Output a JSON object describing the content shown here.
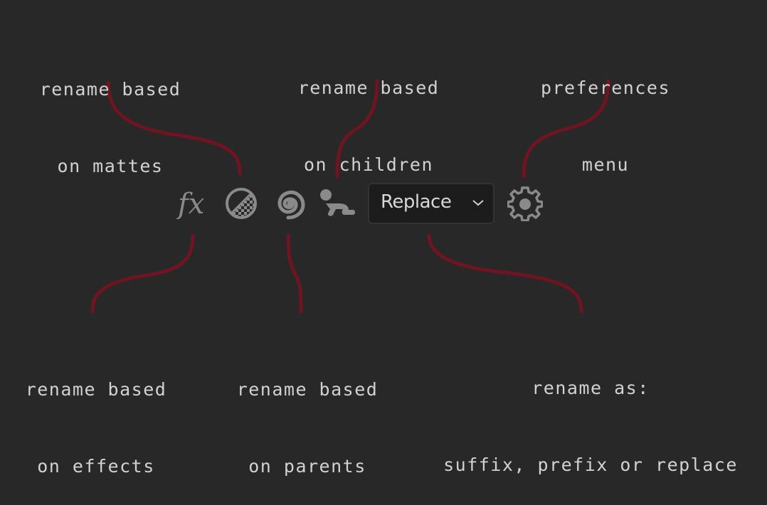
{
  "colors": {
    "background": "#282828",
    "connector": "#6e1423",
    "icon": "#8a8a8a",
    "label_text": "#d2d2d2"
  },
  "toolbar": {
    "icons": [
      {
        "name": "fx-icon",
        "meaning": "effects"
      },
      {
        "name": "matte-icon",
        "meaning": "mattes"
      },
      {
        "name": "spiral-icon",
        "meaning": "parents"
      },
      {
        "name": "child-icon",
        "meaning": "children"
      },
      {
        "name": "gear-icon",
        "meaning": "preferences"
      }
    ],
    "mode_dropdown": {
      "value": "Replace"
    }
  },
  "annotations": {
    "mattes": {
      "line1": "rename based",
      "line2": "on mattes"
    },
    "children": {
      "line1": "rename based",
      "line2": "on children"
    },
    "preferences": {
      "line1": "preferences",
      "line2": "menu"
    },
    "effects": {
      "line1": "rename based",
      "line2": "on effects"
    },
    "parents": {
      "line1": "rename based",
      "line2": "on parents"
    },
    "rename_as": {
      "line1": "rename as:",
      "line2": "suffix, prefix or replace"
    }
  }
}
